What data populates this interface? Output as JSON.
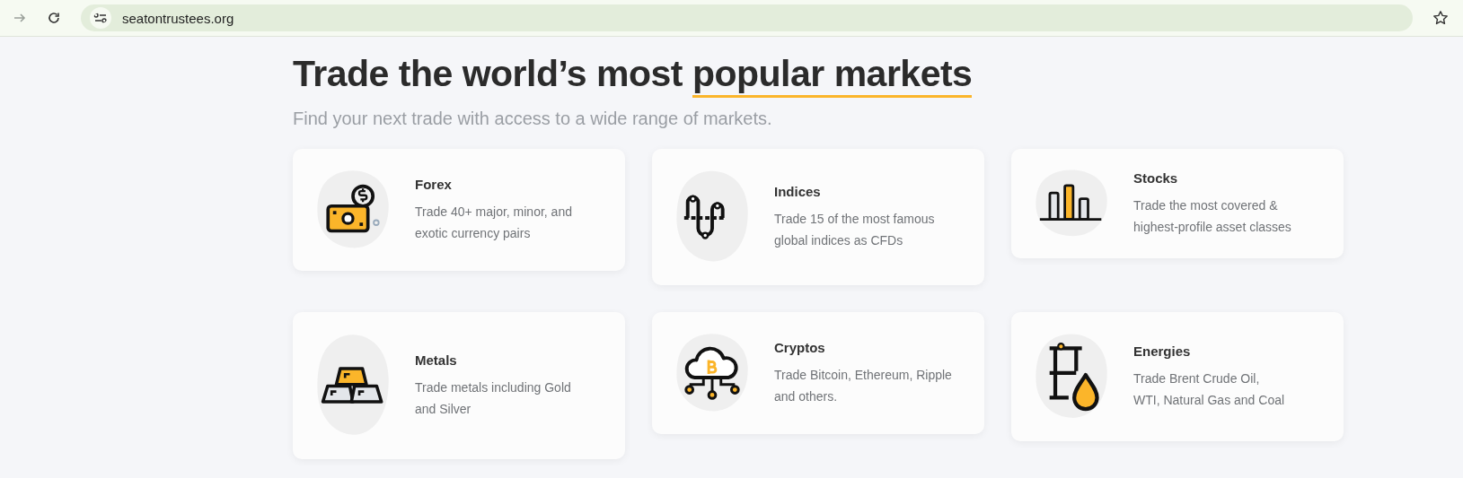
{
  "browser": {
    "url": "seatontrustees.org"
  },
  "heading": {
    "text": "Trade the world’s most",
    "highlight": "popular markets"
  },
  "subtitle": "Find your next trade with access to a wide range of markets.",
  "markets": [
    {
      "kind": "forex",
      "title": "Forex",
      "description": "Trade 40+ major, minor, and exotic currency pairs"
    },
    {
      "kind": "indices",
      "title": "Indices",
      "description": "Trade 15 of the most famous global indices as CFDs"
    },
    {
      "kind": "stocks",
      "title": "Stocks",
      "description": "Trade the most covered & highest-profile asset classes"
    },
    {
      "kind": "metals",
      "title": "Metals",
      "description": "Trade metals including Gold and Silver"
    },
    {
      "kind": "cryptos",
      "title": "Cryptos",
      "description": "Trade Bitcoin, Ethereum, Ripple and others."
    },
    {
      "kind": "energies",
      "title": "Energies",
      "description": "Trade Brent Crude Oil, WTI, Natural Gas and Coal"
    }
  ]
}
